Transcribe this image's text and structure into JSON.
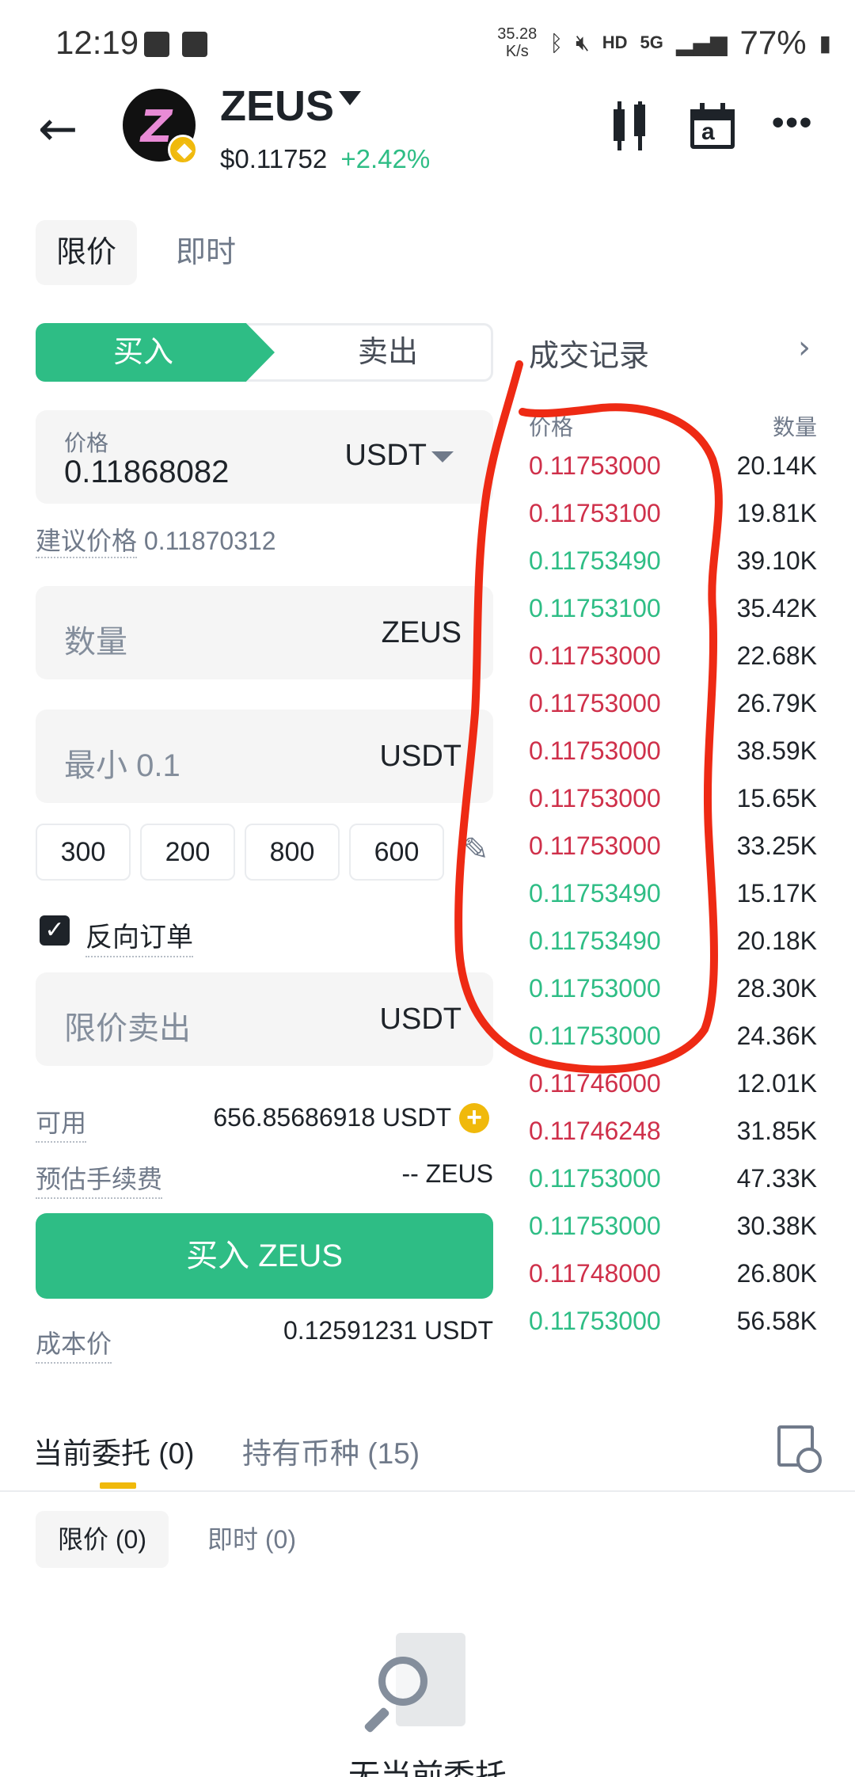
{
  "status_bar": {
    "time": "12:19",
    "net_speed_value": "35.28",
    "net_speed_unit": "K/s",
    "hd": "HD",
    "net_type": "5G",
    "battery": "77%"
  },
  "header": {
    "symbol": "ZEUS",
    "price": "$0.11752",
    "change": "+2.42%",
    "candle_icon": "candlestick-chart-icon",
    "calendar_icon": "calendar-icon",
    "more_icon": "more-icon"
  },
  "order_types": {
    "active": "限价",
    "other": "即时"
  },
  "side_tabs": {
    "buy": "买入",
    "sell": "卖出"
  },
  "price_field": {
    "label": "价格",
    "value": "0.11868082",
    "unit": "USDT"
  },
  "suggested_price": {
    "label": "建议价格",
    "value": "0.11870312"
  },
  "quantity_field": {
    "placeholder": "数量",
    "unit": "ZEUS"
  },
  "min_field": {
    "placeholder": "最小 0.1",
    "unit": "USDT"
  },
  "amount_chips": [
    "300",
    "200",
    "800",
    "600"
  ],
  "reverse_order": {
    "label": "反向订单",
    "checked": true
  },
  "limit_sell_field": {
    "placeholder": "限价卖出",
    "unit": "USDT"
  },
  "available": {
    "label": "可用",
    "value": "656.85686918 USDT"
  },
  "fee": {
    "label": "预估手续费",
    "value": "-- ZEUS"
  },
  "buy_button": {
    "label": "买入 ZEUS"
  },
  "cost_price": {
    "label": "成本价",
    "value": "0.12591231 USDT"
  },
  "trade_records": {
    "title": "成交记录",
    "col_price": "价格",
    "col_qty": "数量",
    "rows": [
      {
        "price": "0.11753000",
        "qty": "20.14K",
        "side": "sell"
      },
      {
        "price": "0.11753100",
        "qty": "19.81K",
        "side": "sell"
      },
      {
        "price": "0.11753490",
        "qty": "39.10K",
        "side": "buy"
      },
      {
        "price": "0.11753100",
        "qty": "35.42K",
        "side": "buy"
      },
      {
        "price": "0.11753000",
        "qty": "22.68K",
        "side": "sell"
      },
      {
        "price": "0.11753000",
        "qty": "26.79K",
        "side": "sell"
      },
      {
        "price": "0.11753000",
        "qty": "38.59K",
        "side": "sell"
      },
      {
        "price": "0.11753000",
        "qty": "15.65K",
        "side": "sell"
      },
      {
        "price": "0.11753000",
        "qty": "33.25K",
        "side": "sell"
      },
      {
        "price": "0.11753490",
        "qty": "15.17K",
        "side": "buy"
      },
      {
        "price": "0.11753490",
        "qty": "20.18K",
        "side": "buy"
      },
      {
        "price": "0.11753000",
        "qty": "28.30K",
        "side": "buy"
      },
      {
        "price": "0.11753000",
        "qty": "24.36K",
        "side": "buy"
      },
      {
        "price": "0.11746000",
        "qty": "12.01K",
        "side": "sell"
      },
      {
        "price": "0.11746248",
        "qty": "31.85K",
        "side": "sell"
      },
      {
        "price": "0.11753000",
        "qty": "47.33K",
        "side": "buy"
      },
      {
        "price": "0.11753000",
        "qty": "30.38K",
        "side": "buy"
      },
      {
        "price": "0.11748000",
        "qty": "26.80K",
        "side": "sell"
      },
      {
        "price": "0.11753000",
        "qty": "56.58K",
        "side": "buy"
      }
    ]
  },
  "bottom_tabs": {
    "open_orders": "当前委托 (0)",
    "holdings": "持有币种 (15)"
  },
  "sub_tabs": {
    "limit": "限价 (0)",
    "market": "即时 (0)"
  },
  "empty_state": {
    "text": "无当前委托"
  },
  "colors": {
    "buy": "#2ebd85",
    "sell": "#cf304a",
    "accent": "#f0b90b",
    "annotation": "#ee2a14"
  }
}
